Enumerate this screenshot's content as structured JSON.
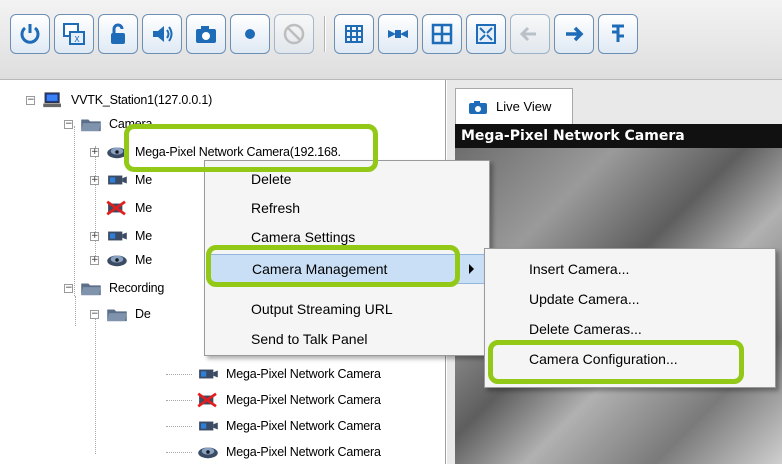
{
  "toolbar": {
    "buttons": [
      {
        "name": "power-icon"
      },
      {
        "name": "switch-window-icon"
      },
      {
        "name": "lock-icon"
      },
      {
        "name": "speaker-icon"
      },
      {
        "name": "camera-snapshot-icon"
      },
      {
        "name": "record-icon"
      },
      {
        "name": "disabled-icon"
      },
      {
        "name": "grid-layout-icon"
      },
      {
        "name": "ptz-icon"
      },
      {
        "name": "split-view-icon"
      },
      {
        "name": "fullscreen-icon"
      },
      {
        "name": "back-arrow-icon"
      },
      {
        "name": "forward-arrow-icon"
      },
      {
        "name": "exit-icon"
      }
    ]
  },
  "tree": {
    "station": "VVTK_Station1(127.0.0.1)",
    "camera_group": "Camera",
    "selected_camera": "Mega-Pixel Network Camera(192.168.",
    "partial_items": [
      "Me",
      "Me",
      "Me",
      "Me"
    ],
    "recording_group": "Recording",
    "device_group": "De",
    "recording_cameras": [
      "Mega-Pixel Network Camera",
      "Mega-Pixel Network Camera",
      "Mega-Pixel Network Camera",
      "Mega-Pixel Network Camera"
    ]
  },
  "context_menu": {
    "items": [
      "Delete",
      "Refresh",
      "Camera Settings",
      "Camera Management",
      "Output Streaming URL",
      "Send to Talk Panel"
    ]
  },
  "submenu": {
    "items": [
      "Insert Camera...",
      "Update Camera...",
      "Delete Cameras...",
      "Camera Configuration..."
    ]
  },
  "viewer": {
    "tab_label": "Live View",
    "video_title": "Mega-Pixel Network Camera"
  },
  "colors": {
    "highlight_green": "#92c816",
    "menu_highlight": "#c9dff5",
    "toolbar_blue": "#1e6bb8"
  }
}
